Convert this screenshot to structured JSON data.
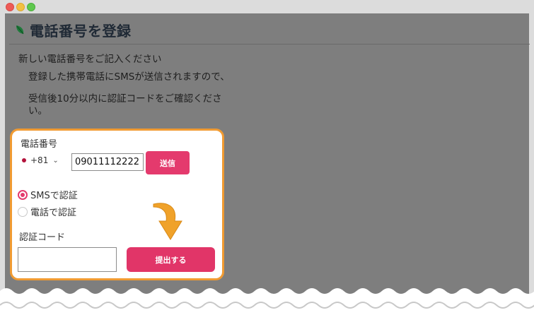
{
  "page": {
    "title": "電話番号を登録",
    "intro": "新しい電話番号をご記入ください",
    "note1": "登録した携帯電話にSMSが送信されますので、",
    "note2": "受信後10分以内に認証コードをご確認ください。"
  },
  "form": {
    "phone_label": "電話番号",
    "country_code": "+81",
    "phone_value": "09011112222",
    "send_label": "送信",
    "radio_sms": "SMSで認証",
    "radio_tel": "電話で認証",
    "code_label": "認証コード",
    "code_value": "",
    "submit_label": "提出する"
  },
  "colors": {
    "accent": "#e43a6d",
    "highlight": "#f19b32"
  },
  "icons": {
    "leaf": "leaf-icon",
    "chevron": "chevron-down-icon",
    "arrow": "arrow-down-icon"
  }
}
